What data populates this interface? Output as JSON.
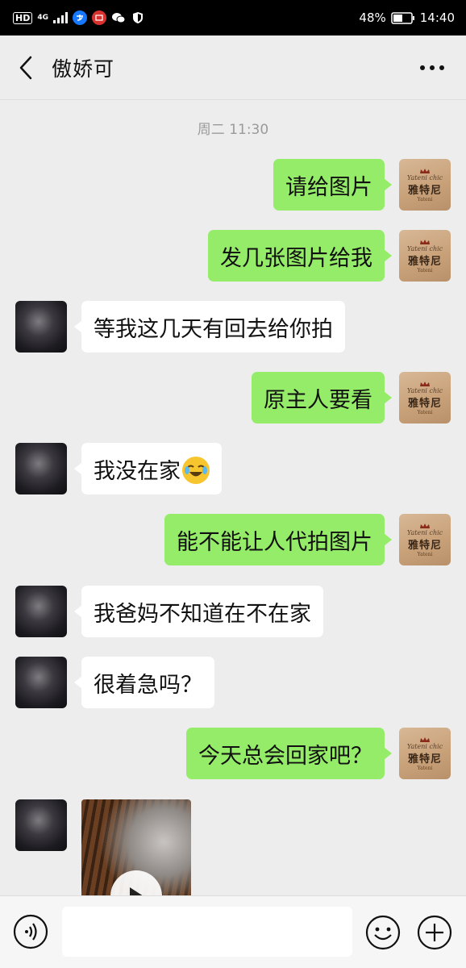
{
  "status_bar": {
    "hd_label": "HD",
    "network": "4G",
    "battery": "48%",
    "time": "14:40"
  },
  "header": {
    "title": "傲娇可"
  },
  "chat": {
    "timestamp": "周二 11:30",
    "my_avatar": {
      "brand_top": "Yateni chic",
      "brand_mid": "雅特尼",
      "brand_bot": "Yateni"
    },
    "messages": [
      {
        "from": "me",
        "text": "请给图片"
      },
      {
        "from": "me",
        "text": "发几张图片给我"
      },
      {
        "from": "them",
        "text": "等我这几天有回去给你拍"
      },
      {
        "from": "me",
        "text": "原主人要看"
      },
      {
        "from": "them",
        "text": "我没在家",
        "emoji": "crying-laughing-emoji"
      },
      {
        "from": "me",
        "text": "能不能让人代拍图片"
      },
      {
        "from": "them",
        "text": "我爸妈不知道在不在家"
      },
      {
        "from": "them",
        "text": "很着急吗？"
      },
      {
        "from": "me",
        "text": "今天总会回家吧？"
      },
      {
        "from": "them",
        "type": "video"
      }
    ]
  },
  "input_bar": {
    "voice_icon": "voice-icon",
    "emoji_icon": "smiley-icon",
    "plus_icon": "plus-icon",
    "text_value": ""
  },
  "colors": {
    "outgoing_bubble": "#95ec69",
    "incoming_bubble": "#ffffff",
    "background": "#ededed"
  }
}
